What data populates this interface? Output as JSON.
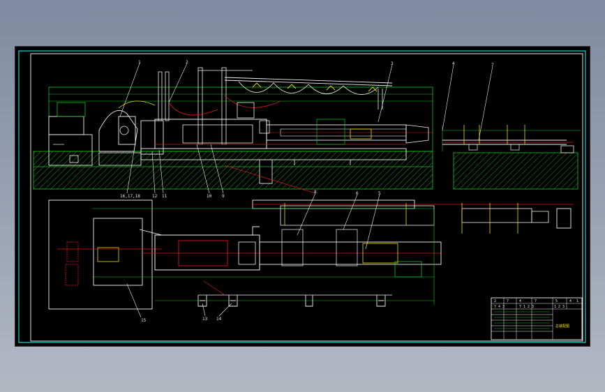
{
  "drawing": {
    "border_color": "#1fd3d0",
    "frame_color": "#ffffff",
    "section_color": "#14c81e",
    "equipment_color": "#f2f2f2",
    "centerline_color": "#e01818",
    "annotation_color": "#f0e000",
    "background": "#000000"
  },
  "elevation_callouts": [
    "1",
    "2",
    "3",
    "4",
    "7"
  ],
  "lower_callouts": [
    "16,17,18",
    "12",
    "11",
    "10",
    "9"
  ],
  "plan_callouts": [
    "8",
    "6",
    "5",
    "15",
    "13",
    "14"
  ],
  "title_block": {
    "header_cells": [
      "2",
      "7",
      "4",
      "7",
      "5",
      "4",
      "1"
    ],
    "code_cells": [
      "7 4 3",
      "7 1 2 3",
      "1 2 3"
    ],
    "drawing_title": "总装配图"
  }
}
